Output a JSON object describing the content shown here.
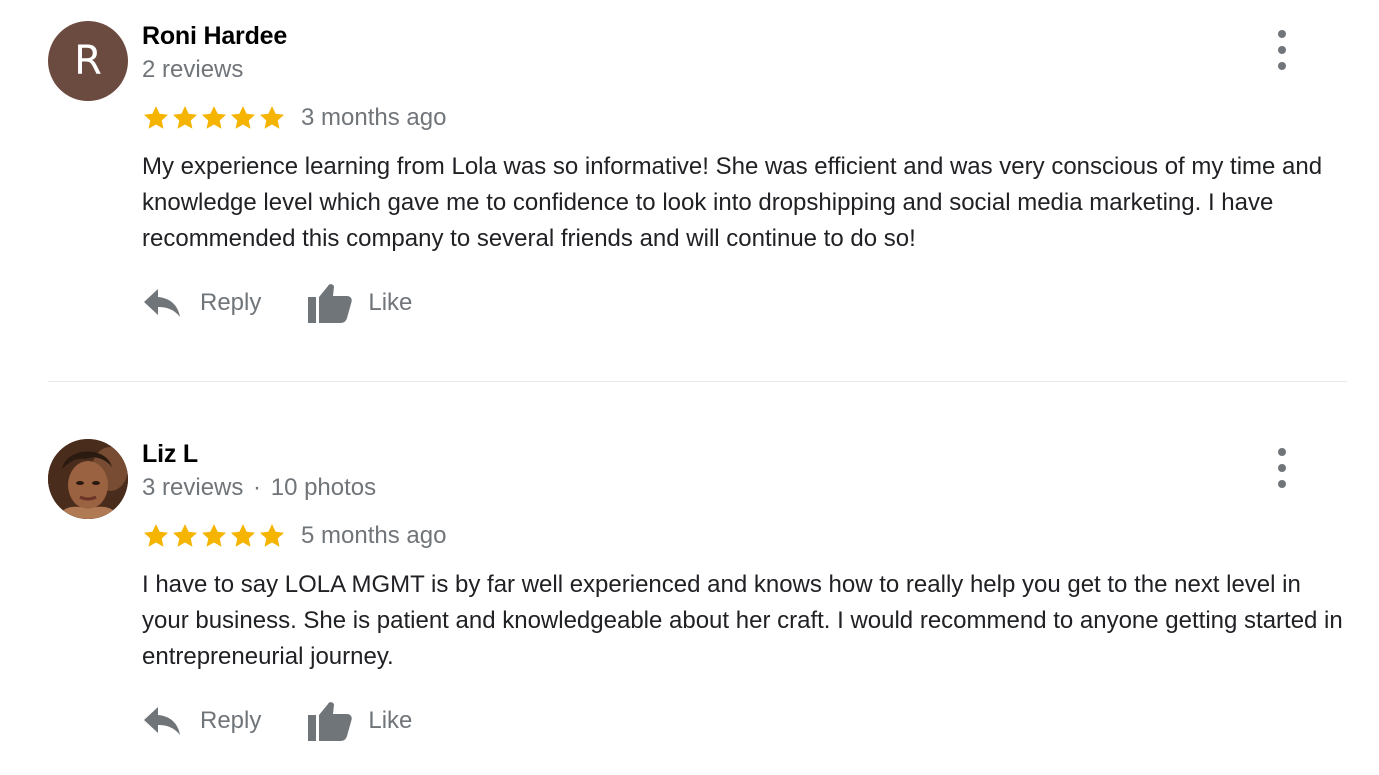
{
  "reviews": [
    {
      "avatar_letter": "R",
      "avatar_color": "#6b4a3f",
      "name": "Roni Hardee",
      "meta": "2 reviews",
      "rating": 5,
      "time": "3 months ago",
      "text": "My experience learning from Lola was so informative! She was efficient and was very conscious of my time and knowledge level which gave me to confidence to look into dropshipping and social media marketing. I have recommended this company to several friends and will continue to do so!",
      "reply_label": "Reply",
      "like_label": "Like"
    },
    {
      "avatar_icon": "profile-photo-icon",
      "name": "Liz L",
      "meta_reviews": "3 reviews",
      "meta_sep": "·",
      "meta_photos": "10 photos",
      "rating": 5,
      "time": "5 months ago",
      "text": "I have to say LOLA MGMT is by far well experienced and knows how to really help you get to the next level in your business. She is patient and knowledgeable about her craft. I would recommend to anyone getting started in entrepreneurial journey.",
      "reply_label": "Reply",
      "like_label": "Like"
    }
  ],
  "colors": {
    "star": "#f4b400",
    "secondary_text": "#70757a",
    "divider": "#e8eaed"
  },
  "icons": [
    "reply-icon",
    "thumbs-up-icon",
    "more-vert-icon",
    "star-icon"
  ]
}
